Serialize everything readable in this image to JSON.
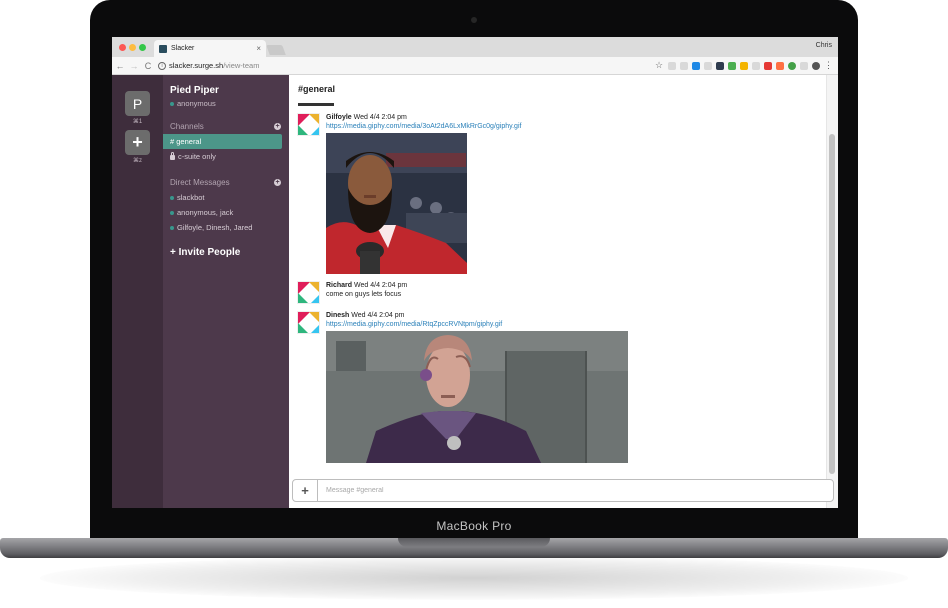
{
  "device": {
    "label": "MacBook Pro"
  },
  "browser": {
    "tab_title": "Slacker",
    "tab_close": "×",
    "profile_name": "Chris",
    "back": "←",
    "forward": "→",
    "reload": "C",
    "url_host": "slacker.surge.sh",
    "url_path": "/view-team",
    "star": "☆",
    "menu": "⋮"
  },
  "app": {
    "team_initial": "P",
    "team_add": "+",
    "team_shortcut_1": "⌘1",
    "team_shortcut_2": "⌘z",
    "team_name": "Pied Piper",
    "current_user": "anonymous",
    "channels_header": "Channels",
    "channels": [
      {
        "label": "# general"
      },
      {
        "label": "c-suite only"
      }
    ],
    "dm_header": "Direct Messages",
    "direct_messages": [
      {
        "label": "slackbot"
      },
      {
        "label": "anonymous, jack"
      },
      {
        "label": "Gilfoyle, Dinesh, Jared"
      }
    ],
    "invite_label": "+ Invite People",
    "section_add": "+"
  },
  "channel": {
    "title": "#general",
    "messages": [
      {
        "author": "Gilfoyle",
        "time": "Wed 4/4 2:04 pm",
        "link": "https://media.giphy.com/media/3oAt2dA6LxMkRrGc0g/giphy.gif"
      },
      {
        "author": "Richard",
        "time": "Wed 4/4 2:04 pm",
        "text": "come on guys lets focus"
      },
      {
        "author": "Dinesh",
        "time": "Wed 4/4 2:04 pm",
        "link": "https://media.giphy.com/media/RtqZpccRVNtpm/giphy.gif"
      }
    ]
  },
  "composer": {
    "add": "+",
    "placeholder": "Message #general"
  },
  "colors": {
    "sidebar": "#4d394b",
    "team_rail": "#3e2d3c",
    "active_channel": "#4c9689",
    "presence": "#38978d",
    "link": "#2a80b9"
  },
  "icons": [
    "back-arrow-icon",
    "forward-arrow-icon",
    "reload-icon",
    "info-icon",
    "star-icon",
    "lock-icon",
    "plus-icon",
    "menu-dots-icon"
  ]
}
